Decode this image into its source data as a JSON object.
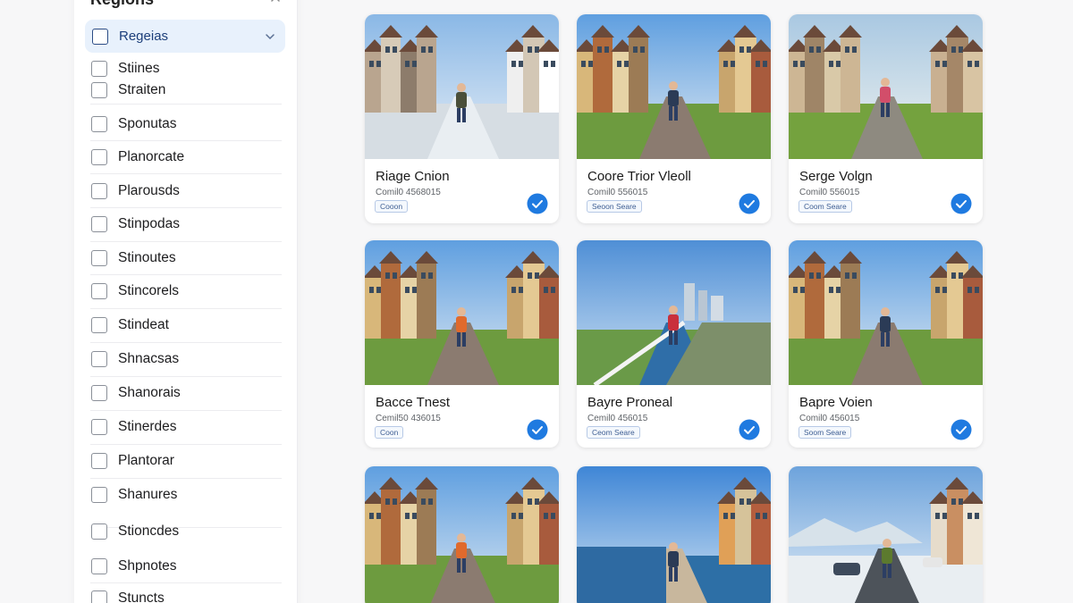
{
  "sidebar": {
    "title": "Regions",
    "selected": {
      "label": "Regeias"
    },
    "items": [
      {
        "label": "Stiines"
      },
      {
        "label": "Straiten"
      },
      {
        "label": "Sponutas"
      },
      {
        "label": "Planorcate"
      },
      {
        "label": "Plarousds"
      },
      {
        "label": "Stinpodas"
      },
      {
        "label": "Stinoutes"
      },
      {
        "label": "Stincorels"
      },
      {
        "label": "Stindeat"
      },
      {
        "label": "Shnacsas"
      },
      {
        "label": "Shanorais"
      },
      {
        "label": "Stinerdes"
      },
      {
        "label": "Plantorar"
      },
      {
        "label": "Shanures"
      },
      {
        "label": "Stioncdes"
      },
      {
        "label": "Shpnotes"
      },
      {
        "label": "Stuncts"
      }
    ]
  },
  "cards": [
    {
      "title": "Riage Cnion",
      "meta": "Comil0 4568015",
      "tag": "Cooon",
      "scene": "snow-street",
      "selected": true
    },
    {
      "title": "Coore Trior Vleoll",
      "meta": "Comil0 556015",
      "tag": "Seoon Seare",
      "scene": "old-town-street",
      "selected": true
    },
    {
      "title": "Serge Volgn",
      "meta": "Comil0 556015",
      "tag": "Coom Seare",
      "scene": "green-lane",
      "selected": true
    },
    {
      "title": "Bacce Tnest",
      "meta": "Cemil50 436015",
      "tag": "Coon",
      "scene": "sunny-street",
      "selected": true
    },
    {
      "title": "Bayre Proneal",
      "meta": "Cemil0 456015",
      "tag": "Ceom Seare",
      "scene": "waterfront",
      "selected": true
    },
    {
      "title": "Bapre Voien",
      "meta": "Comil0 456015",
      "tag": "Soom Seare",
      "scene": "brick-sidewalk",
      "selected": true
    },
    {
      "title": "",
      "meta": "",
      "tag": "",
      "scene": "sunny-street",
      "selected": false
    },
    {
      "title": "",
      "meta": "",
      "tag": "",
      "scene": "seaside-houses",
      "selected": false
    },
    {
      "title": "",
      "meta": "",
      "tag": "",
      "scene": "snowy-road",
      "selected": false
    }
  ],
  "colors": {
    "accent": "#1f7ae0",
    "selected_bg": "#e8f1fc",
    "page_bg": "#f7f7f8"
  },
  "icons": {
    "collapse": "chevron-up-icon",
    "dropdown": "chevron-down-icon",
    "selected": "check-circle-icon"
  }
}
